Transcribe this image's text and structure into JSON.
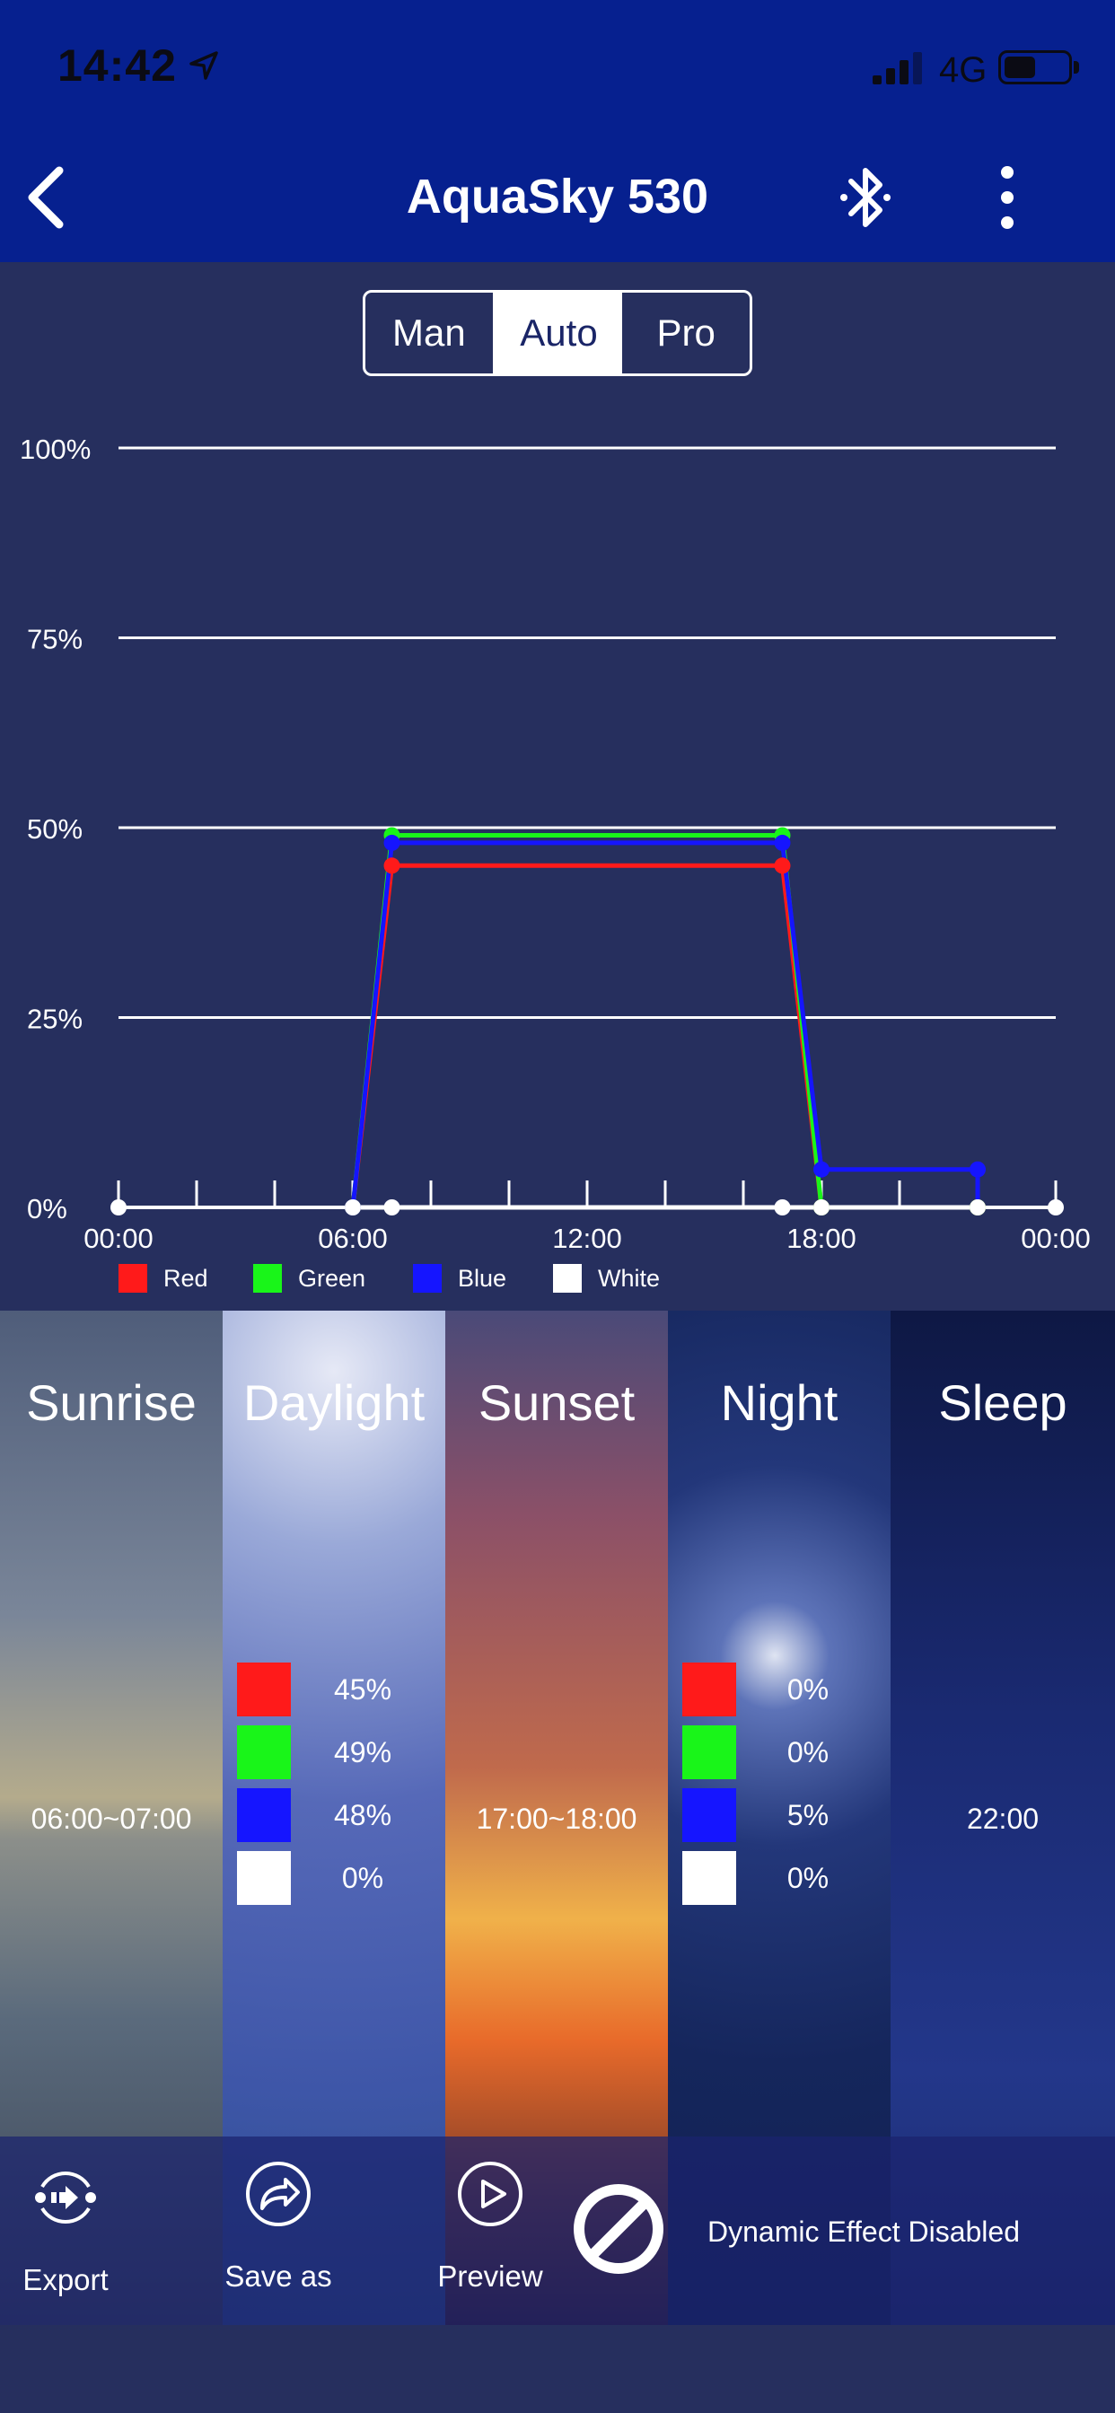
{
  "status_bar": {
    "time": "14:42",
    "network": "4G"
  },
  "header": {
    "title": "AquaSky 530"
  },
  "mode_tabs": [
    {
      "label": "Man",
      "active": false
    },
    {
      "label": "Auto",
      "active": true
    },
    {
      "label": "Pro",
      "active": false
    }
  ],
  "chart_data": {
    "type": "line",
    "y_ticks": [
      "100%",
      "75%",
      "50%",
      "25%",
      "0%"
    ],
    "x_ticks": [
      "00:00",
      "06:00",
      "12:00",
      "18:00",
      "00:00"
    ],
    "ylim": [
      0,
      100
    ],
    "xlim": [
      0,
      24
    ],
    "grid": true,
    "series": [
      {
        "name": "Red",
        "color": "#ff1a1a",
        "points": [
          [
            6,
            0
          ],
          [
            7,
            45
          ],
          [
            17,
            45
          ],
          [
            18,
            0
          ],
          [
            22,
            0
          ]
        ]
      },
      {
        "name": "Green",
        "color": "#19f519",
        "points": [
          [
            6,
            0
          ],
          [
            7,
            49
          ],
          [
            17,
            49
          ],
          [
            18,
            0
          ],
          [
            22,
            0
          ]
        ]
      },
      {
        "name": "Blue",
        "color": "#1515ff",
        "points": [
          [
            6,
            0
          ],
          [
            7,
            48
          ],
          [
            17,
            48
          ],
          [
            18,
            5
          ],
          [
            22,
            5
          ],
          [
            22,
            0
          ]
        ]
      },
      {
        "name": "White",
        "color": "#ffffff",
        "points": [
          [
            6,
            0
          ],
          [
            7,
            0
          ],
          [
            17,
            0
          ],
          [
            18,
            0
          ],
          [
            22,
            0
          ]
        ]
      }
    ]
  },
  "scenes": [
    {
      "title": "Sunrise",
      "time": "06:00~07:00"
    },
    {
      "title": "Daylight",
      "values": [
        "45%",
        "49%",
        "48%",
        "0%"
      ]
    },
    {
      "title": "Sunset",
      "time": "17:00~18:00"
    },
    {
      "title": "Night",
      "values": [
        "0%",
        "0%",
        "5%",
        "0%"
      ]
    },
    {
      "title": "Sleep",
      "time": "22:00"
    }
  ],
  "toolbar": {
    "export": "Export",
    "save_as": "Save as",
    "preview": "Preview",
    "dynamic": "Dynamic Effect Disabled"
  },
  "icons": {
    "back": "chevron-left-icon",
    "bluetooth": "bluetooth-icon",
    "more": "more-vertical-icon",
    "export": "export-icon",
    "save_as": "share-icon",
    "preview": "play-icon",
    "dynamic": "disabled-icon"
  }
}
